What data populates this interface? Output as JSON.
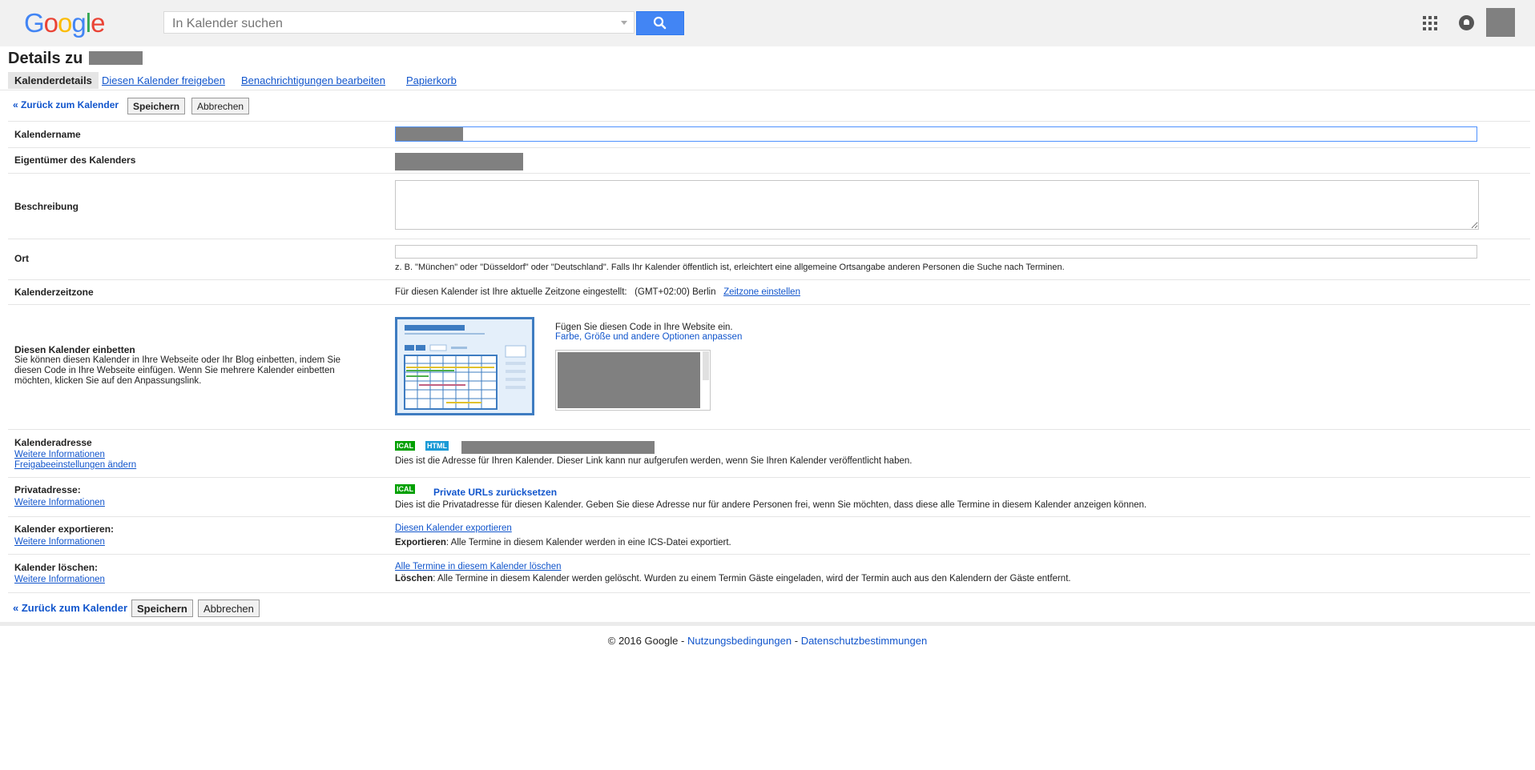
{
  "header": {
    "logo_letters": [
      {
        "ch": "G",
        "color": "#4285f4"
      },
      {
        "ch": "o",
        "color": "#ea4335"
      },
      {
        "ch": "o",
        "color": "#fbbc05"
      },
      {
        "ch": "g",
        "color": "#4285f4"
      },
      {
        "ch": "l",
        "color": "#34a853"
      },
      {
        "ch": "e",
        "color": "#ea4335"
      }
    ],
    "search_placeholder": "In Kalender suchen",
    "icons": [
      "search-icon",
      "apps-icon",
      "notifications-icon",
      "avatar"
    ]
  },
  "page": {
    "title": "Details zu",
    "tabs": [
      {
        "label": "Kalenderdetails",
        "active": true
      },
      {
        "label": "Diesen Kalender freigeben",
        "active": false
      },
      {
        "label": "Benachrichtigungen bearbeiten",
        "active": false
      },
      {
        "label": "Papierkorb",
        "active": false
      }
    ],
    "actions": {
      "back": "« Zurück zum Kalender",
      "save": "Speichern",
      "cancel": "Abbrechen"
    }
  },
  "form": {
    "name": {
      "label": "Kalendername"
    },
    "owner": {
      "label": "Eigentümer des Kalenders"
    },
    "description": {
      "label": "Beschreibung"
    },
    "location": {
      "label": "Ort",
      "hint": "z. B. \"München\" oder \"Düsseldorf\" oder \"Deutschland\". Falls Ihr Kalender öffentlich ist, erleichtert eine allgemeine Ortsangabe anderen Personen die Suche nach Terminen."
    },
    "timezone": {
      "label": "Kalenderzeitzone",
      "text": "Für diesen Kalender ist Ihre aktuelle Zeitzone eingestellt:",
      "value": "(GMT+02:00) Berlin",
      "link": "Zeitzone einstellen"
    },
    "embed": {
      "label": "Diesen Kalender einbetten",
      "help": "Sie können diesen Kalender in Ihre Webseite oder Ihr Blog einbetten, indem Sie diesen Code in Ihre Webseite einfügen. Wenn Sie mehrere Kalender einbetten möchten, klicken Sie auf den Anpassungslink.",
      "code_text": "Fügen Sie diesen Code in Ihre Website ein.",
      "customize_link": "Farbe, Größe und andere Optionen anpassen"
    },
    "address": {
      "label": "Kalenderadresse",
      "more": "Weitere Informationen",
      "sharing_link": "Freigabeeinstellungen ändern",
      "badge_ical": "ICAL",
      "badge_html": "HTML",
      "text": "Dies ist die Adresse für Ihren Kalender. Dieser Link kann nur aufgerufen werden, wenn Sie Ihren Kalender veröffentlicht haben."
    },
    "private": {
      "label": "Privatadresse:",
      "more": "Weitere Informationen",
      "badge_ical": "ICAL",
      "reset_link": "Private URLs zurücksetzen",
      "text": "Dies ist die Privatadresse für diesen Kalender. Geben Sie diese Adresse nur für andere Personen frei, wenn Sie möchten, dass diese alle Termine in diesem Kalender anzeigen können."
    },
    "export": {
      "label": "Kalender exportieren:",
      "more": "Weitere Informationen",
      "link": "Diesen Kalender exportieren",
      "bold": "Exportieren",
      "text": ": Alle Termine in diesem Kalender werden in eine ICS-Datei exportiert."
    },
    "delete": {
      "label": "Kalender löschen:",
      "more": "Weitere Informationen",
      "link": "Alle Termine in diesem Kalender löschen",
      "bold": "Löschen",
      "text": ": Alle Termine in diesem Kalender werden gelöscht. Wurden zu einem Termin Gäste eingeladen, wird der Termin auch aus den Kalendern der Gäste entfernt."
    }
  },
  "footer": {
    "copyright": "© 2016 Google -",
    "terms": "Nutzungsbedingungen",
    "sep": "-",
    "privacy": "Datenschutzbestimmungen"
  },
  "colors": {
    "badge_ical": "#00a000",
    "badge_html": "#1a9ad6",
    "link": "#1155cc",
    "search_button": "#4285f4"
  }
}
